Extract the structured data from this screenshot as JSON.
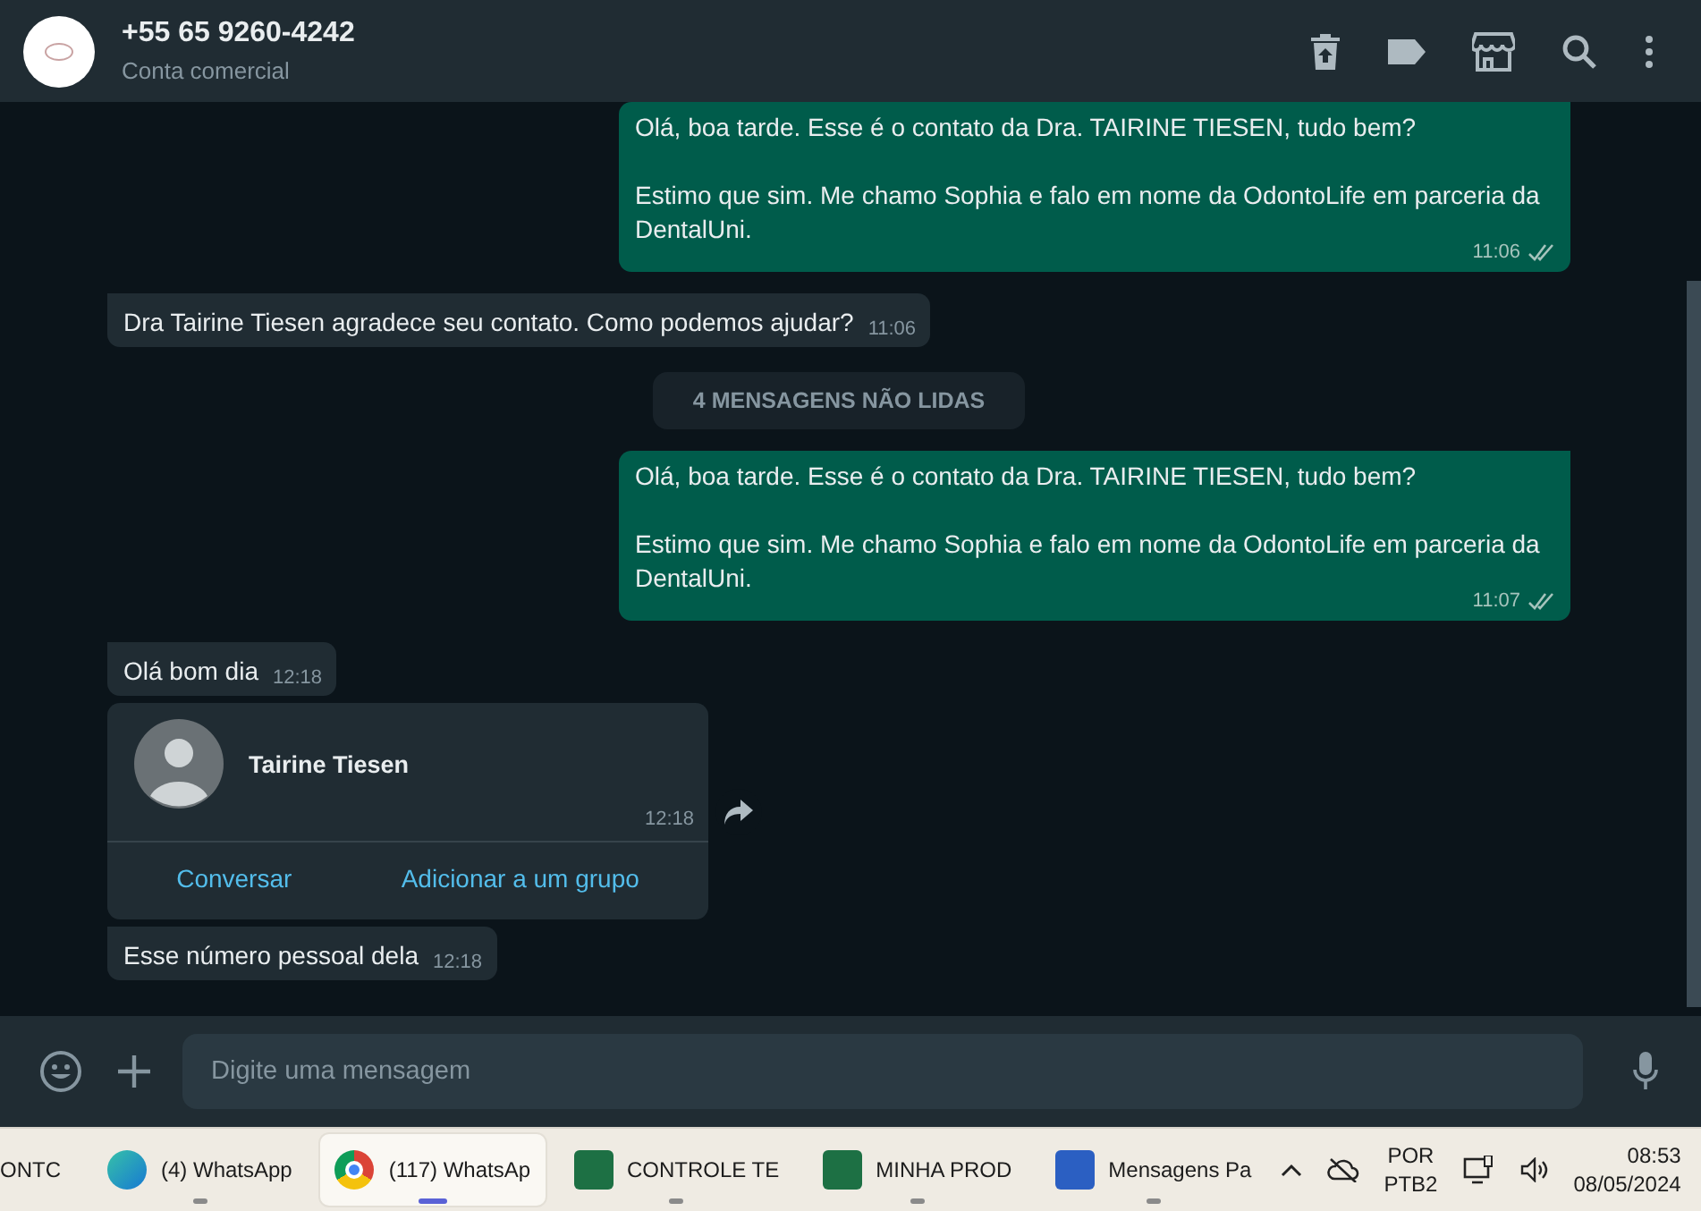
{
  "header": {
    "name": "+55 65 9260-4242",
    "subtitle": "Conta comercial"
  },
  "messages": [
    {
      "kind": "outgoing",
      "lines": [
        "Olá, boa tarde. Esse é o contato da Dra. TAIRINE TIESEN, tudo bem?",
        "Estimo que sim. Me chamo Sophia e falo em nome da OdontoLife em parceria da DentalUni."
      ],
      "time": "11:06",
      "read": false
    },
    {
      "kind": "incoming",
      "text": "Dra Tairine Tiesen agradece seu contato. Como podemos ajudar?",
      "time": "11:06"
    },
    {
      "kind": "divider",
      "text": "4 MENSAGENS NÃO LIDAS"
    },
    {
      "kind": "outgoing",
      "lines": [
        "Olá, boa tarde. Esse é o contato da Dra. TAIRINE TIESEN, tudo bem?",
        "Estimo que sim. Me chamo Sophia e falo em nome da OdontoLife em parceria da DentalUni."
      ],
      "time": "11:07",
      "read": false
    },
    {
      "kind": "incoming",
      "text": "Olá bom dia",
      "time": "12:18"
    },
    {
      "kind": "contact",
      "name": "Tairine Tiesen",
      "time": "12:18",
      "actions": [
        "Conversar",
        "Adicionar a um grupo"
      ]
    },
    {
      "kind": "incoming",
      "text": "Esse número pessoal dela",
      "time": "12:18"
    }
  ],
  "composer": {
    "placeholder": "Digite uma mensagem"
  },
  "taskbar": {
    "items": [
      {
        "kind": "plain",
        "label": "ONTC",
        "selected": false
      },
      {
        "kind": "edge",
        "label": "(4) WhatsApp",
        "selected": false
      },
      {
        "kind": "chrome",
        "label": "(117) WhatsAp",
        "selected": true
      },
      {
        "kind": "excel",
        "label": "CONTROLE TE",
        "selected": false
      },
      {
        "kind": "excel",
        "label": "MINHA PROD",
        "selected": false
      },
      {
        "kind": "word",
        "label": "Mensagens Pa",
        "selected": false
      }
    ],
    "language": "POR",
    "layout": "PTB2",
    "time": "08:53",
    "date": "08/05/2024"
  }
}
